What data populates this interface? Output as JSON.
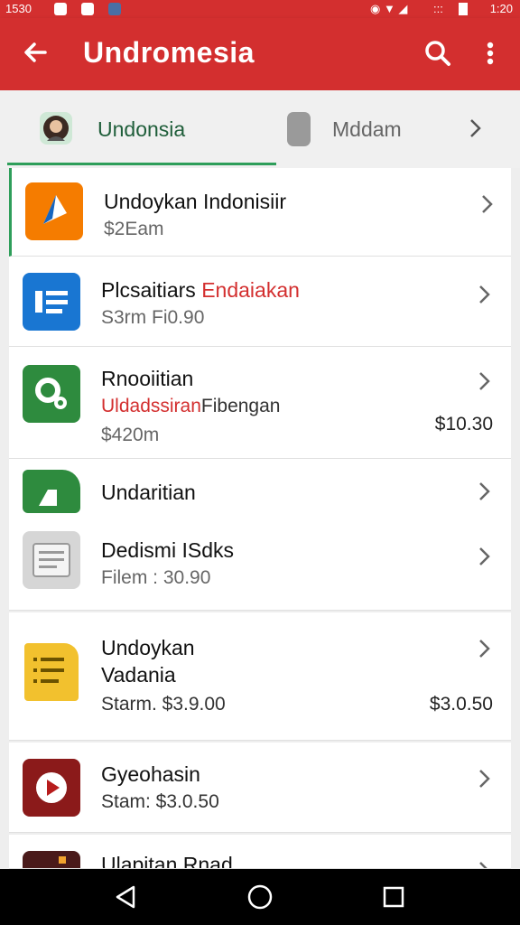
{
  "status_bar": {
    "time": "1530",
    "right_time": "1:20",
    "right_text": ":::",
    "accent": "#d32f2f"
  },
  "app_bar": {
    "title": "Undromesia",
    "icons": [
      "back-arrow-icon",
      "search-icon",
      "more-vert-icon"
    ]
  },
  "tabs": [
    {
      "label": "Undonsia",
      "active": true,
      "color": "#1f5e3a"
    },
    {
      "label": "Mddam",
      "active": false,
      "color": "#666666"
    }
  ],
  "list": [
    {
      "title": "Undoykan Indonisiir",
      "subtitle": "$2Eam",
      "price": "",
      "icon": "triangle-app-icon",
      "icon_color": "#f57c00"
    },
    {
      "title": "Plcsaitiars",
      "title_red": "Endaiakan",
      "subtitle": "S3rm Fi0.90",
      "price": "",
      "icon": "list-app-icon",
      "icon_color": "#1976d2"
    },
    {
      "title": "Rnooiitian",
      "subtitle_red": "Uldadssiran",
      "subtitle": "Fibengan",
      "subtitle2": "$420m",
      "price": "$10.30",
      "icon": "magnifier-app-icon",
      "icon_color": "#2e8b3e"
    },
    {
      "title": "Undaritian",
      "subtitle": "",
      "price": "",
      "icon": "sheets-app-icon",
      "icon_color": "#2e8b3e"
    },
    {
      "title": "Dedismi ISdks",
      "subtitle": "Filem : 30.90",
      "price": "",
      "icon": "document-app-icon",
      "icon_color": "#d0d0d0"
    },
    {
      "title": "Undoykan",
      "title2": "Vadania",
      "subtitle": "Starm. $3.9.00",
      "price": "$3.0.50",
      "icon": "notes-app-icon",
      "icon_color": "#f2c12e"
    },
    {
      "title": "Gyeohasin",
      "subtitle": "Stam: $3.0.50",
      "price": "",
      "icon": "play-app-icon",
      "icon_color": "#b71c1c"
    },
    {
      "title": "Ulapitan Rnad",
      "subtitle": "",
      "price": "",
      "icon": "film-app-icon",
      "icon_color": "#5d1f1f"
    }
  ],
  "nav_bar": {
    "icons": [
      "back-triangle-icon",
      "home-circle-icon",
      "recents-square-icon"
    ]
  }
}
